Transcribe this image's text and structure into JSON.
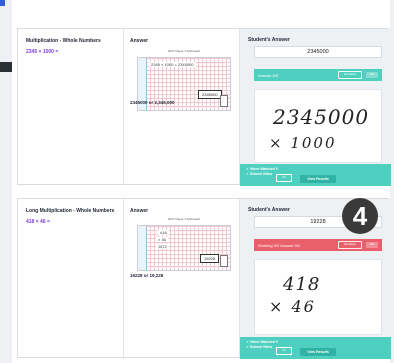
{
  "columns": {
    "answer": "Answer",
    "student": "Student's Answer"
  },
  "q1": {
    "title": "Multiplication - Whole Numbers",
    "expr": "2345 × 1000 =",
    "img_caption": "2017 Paper 1 Arithmetic",
    "img_work": "2345 × 1000 = 2345000",
    "img_boxed": "2345000",
    "correct": "2345000 or 2,345,000",
    "student_value": "2345000",
    "status": "Answer 5/5",
    "status_btn1": "Edit Marks",
    "status_btn2": "Edit",
    "hw_line1": "2345000",
    "hw_line2": "× 1000",
    "footer_line1": "✓ Video Watched  0",
    "footer_line2": "✓ Submit Video",
    "footer_btn": "2/3",
    "view_results": "View Results"
  },
  "q2": {
    "title": "Long Multiplication - Whole Numbers",
    "expr": "418 × 46 =",
    "img_caption": "2017 Paper 1 Arithmetic",
    "img_work_top": "418",
    "img_work_mid": "× 46",
    "img_work_low": "1672",
    "img_boxed": "19228",
    "correct": "19228 or 19,228",
    "student_value": "19228",
    "status": "Working 0/2   Answer 0/2",
    "status_btn1": "Edit Marks",
    "status_btn2": "Edit",
    "hw_line1": "418",
    "hw_line2": "× 46",
    "footer_line1": "✓ Video Watched  0",
    "footer_line2": "✓ Submit Video",
    "footer_btn": "0/3",
    "view_results": "View Results"
  },
  "badge": "4",
  "colors": {
    "accent_purple": "#7b3fe4",
    "teal": "#4fcfc0",
    "red": "#e9606b"
  }
}
